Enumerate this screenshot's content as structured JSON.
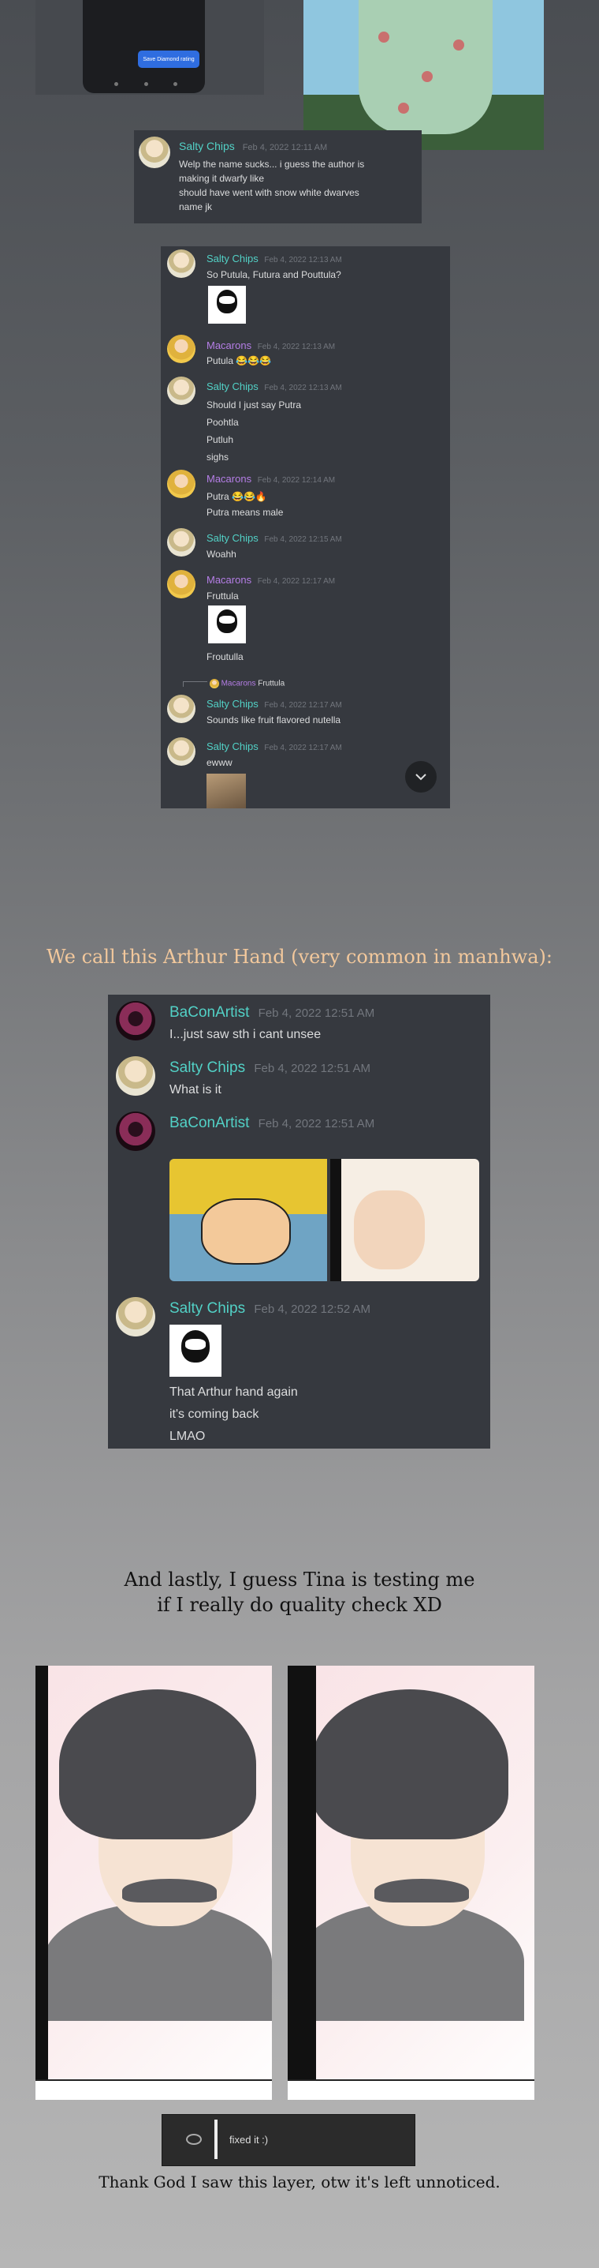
{
  "top": {
    "phone_button_label": "Save Diamond rating",
    "snippet1": {
      "name": "Salty Chips",
      "time": "Feb 4, 2022 12:11 AM",
      "lines": [
        "Welp the name sucks... i guess the author is",
        "making it dwarfy like",
        "should have went with snow white  dwarves",
        "name jk"
      ]
    }
  },
  "chat1": {
    "messages": [
      {
        "name": "Salty Chips",
        "time": "Feb 4, 2022 12:13 AM",
        "lines": [
          "So Putula, Futura and Pouttula?"
        ]
      },
      {
        "name": "Macarons",
        "time": "Feb 4, 2022 12:13 AM",
        "lines": [
          "Putula 😂😂😂"
        ]
      },
      {
        "name": "Salty Chips",
        "time": "Feb 4, 2022 12:13 AM",
        "lines": [
          "Should I just say Putra",
          "Poohtla",
          "Putluh",
          "sighs"
        ]
      },
      {
        "name": "Macarons",
        "time": "Feb 4, 2022 12:14 AM",
        "lines": [
          "Putra 😂😂🔥",
          "Putra means male"
        ]
      },
      {
        "name": "Salty Chips",
        "time": "Feb 4, 2022 12:15 AM",
        "lines": [
          "Woahh"
        ]
      },
      {
        "name": "Macarons",
        "time": "Feb 4, 2022 12:17 AM",
        "lines": [
          "Fruttula",
          "Froutulla"
        ]
      },
      {
        "name": "Salty Chips",
        "time": "Feb 4, 2022 12:17 AM",
        "lines": [
          "Sounds like fruit flavored nutella"
        ]
      },
      {
        "name": "Salty Chips",
        "time": "Feb 4, 2022 12:17 AM",
        "lines": [
          "ewww"
        ]
      }
    ],
    "reply_name": "Macarons",
    "reply_text": "Fruttula"
  },
  "arthur": {
    "title": "We call this Arthur Hand (very common in manhwa):",
    "messages": [
      {
        "name": "BaConArtist",
        "time": "Feb 4, 2022 12:51 AM",
        "lines": [
          "I...just saw sth i cant unsee"
        ]
      },
      {
        "name": "Salty Chips",
        "time": "Feb 4, 2022 12:51 AM",
        "lines": [
          "What is it"
        ]
      },
      {
        "name": "BaConArtist",
        "time": "Feb 4, 2022 12:51 AM",
        "lines": []
      },
      {
        "name": "Salty Chips",
        "time": "Feb 4, 2022 12:52 AM",
        "lines": [
          "That Arthur hand again",
          "it's coming back",
          "LMAO"
        ]
      }
    ]
  },
  "lastly": {
    "line1": "And lastly, I guess Tina is testing me",
    "line2": "if I really do quality check XD",
    "layer_label": "fixed it :)",
    "caption": "Thank God I saw this layer, otw it's left unnoticed."
  }
}
